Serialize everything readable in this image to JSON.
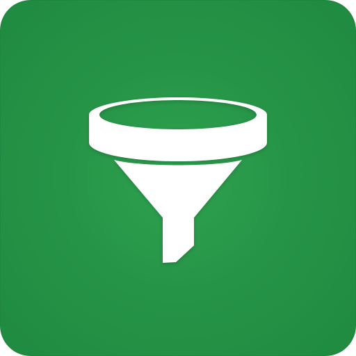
{
  "app_icon": {
    "icon_name": "funnel-icon",
    "colors": {
      "background": "#269447",
      "background_light": "#2ea24f",
      "background_dark": "#1f8a40",
      "glyph": "#ffffff"
    }
  }
}
